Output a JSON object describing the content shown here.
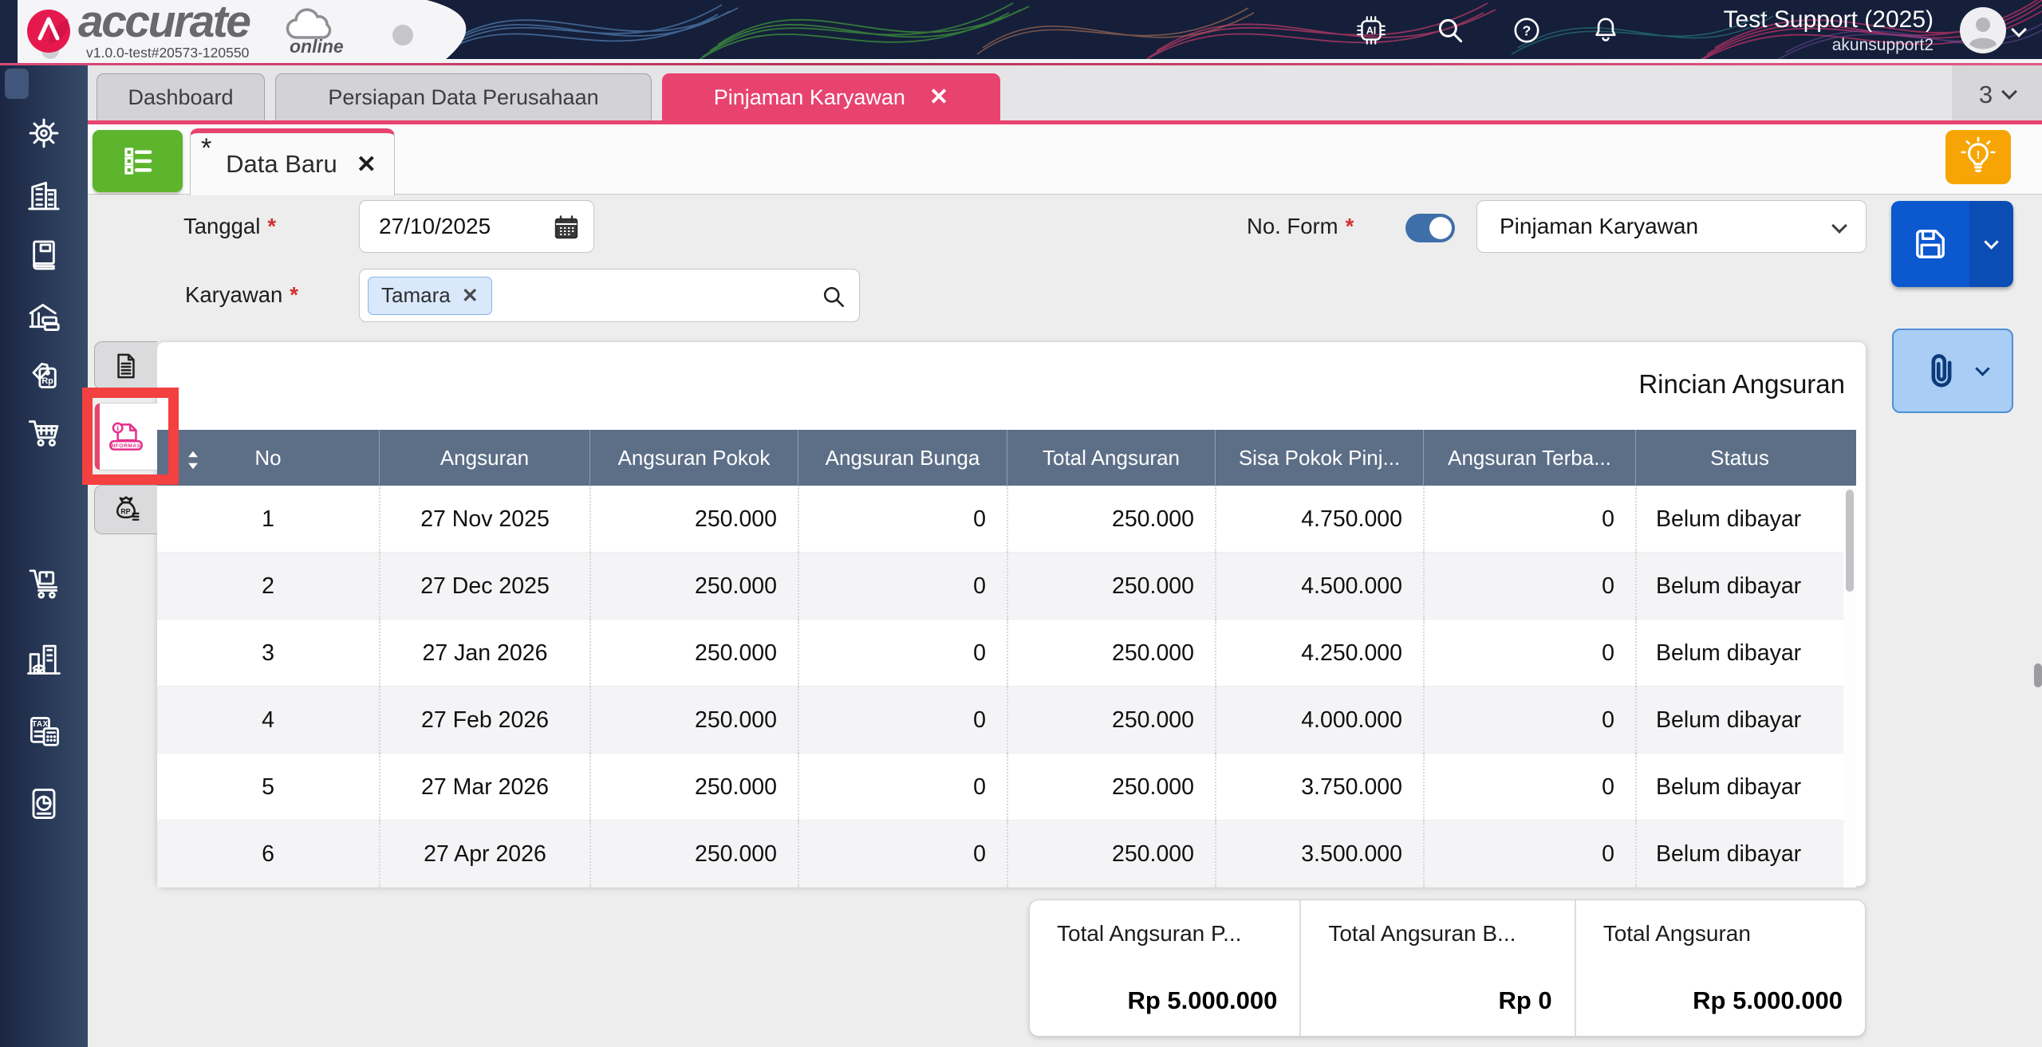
{
  "topbar": {
    "brand": "accurate",
    "brand_suffix": "online",
    "version": "v1.0.0-test#20573-120550",
    "user": {
      "name": "Test Support (2025)",
      "account": "akunsupport2"
    },
    "icons": [
      "ai-icon",
      "search-icon",
      "help-icon",
      "notifications-icon",
      "avatar",
      "chevron-down-icon"
    ]
  },
  "tabbar": {
    "tabs": [
      {
        "label": "Dashboard",
        "active": false
      },
      {
        "label": "Persiapan Data Perusahaan",
        "active": false
      },
      {
        "label": "Pinjaman Karyawan",
        "active": true,
        "closable": true
      }
    ],
    "overflow_count": "3"
  },
  "subtab": {
    "dirty_marker": "*",
    "label": "Data Baru",
    "closable": true,
    "list_button_icon": "list-icon"
  },
  "form": {
    "required_marker": "*",
    "tanggal": {
      "label": "Tanggal",
      "value": "27/10/2025",
      "icon": "calendar-icon"
    },
    "karyawan": {
      "label": "Karyawan",
      "chip": "Tamara",
      "icon": "search-icon"
    },
    "no_form": {
      "label": "No. Form",
      "toggle_on": true,
      "selected": "Pinjaman Karyawan"
    }
  },
  "panel": {
    "title": "Rincian Angsuran"
  },
  "table": {
    "columns": [
      "No",
      "Angsuran",
      "Angsuran Pokok",
      "Angsuran Bunga",
      "Total Angsuran",
      "Sisa Pokok Pinj...",
      "Angsuran Terba...",
      "Status"
    ],
    "rows": [
      [
        "1",
        "27 Nov 2025",
        "250.000",
        "0",
        "250.000",
        "4.750.000",
        "0",
        "Belum dibayar"
      ],
      [
        "2",
        "27 Dec 2025",
        "250.000",
        "0",
        "250.000",
        "4.500.000",
        "0",
        "Belum dibayar"
      ],
      [
        "3",
        "27 Jan 2026",
        "250.000",
        "0",
        "250.000",
        "4.250.000",
        "0",
        "Belum dibayar"
      ],
      [
        "4",
        "27 Feb 2026",
        "250.000",
        "0",
        "250.000",
        "4.000.000",
        "0",
        "Belum dibayar"
      ],
      [
        "5",
        "27 Mar 2026",
        "250.000",
        "0",
        "250.000",
        "3.750.000",
        "0",
        "Belum dibayar"
      ],
      [
        "6",
        "27 Apr 2026",
        "250.000",
        "0",
        "250.000",
        "3.500.000",
        "0",
        "Belum dibayar"
      ]
    ]
  },
  "totals": [
    {
      "label": "Total Angsuran P...",
      "value": "Rp 5.000.000"
    },
    {
      "label": "Total Angsuran B...",
      "value": "Rp 0"
    },
    {
      "label": "Total Angsuran",
      "value": "Rp 5.000.000"
    }
  ],
  "symbols": {
    "close": "✕",
    "question": "?",
    "ai": "AI",
    "tax": "TAX",
    "rp_bag": "RP",
    "rp_tag": "Rp",
    "informasi": "INFORMASI",
    "bang": "!"
  },
  "sidebar": {
    "items": [
      "settings-icon",
      "company-icon",
      "journal-book-icon",
      "cash-bank-icon",
      "sales-rp-tag-icon",
      "purchase-cart-icon",
      "inventory-trolley-icon",
      "fixed-assets-icon",
      "tax-icon",
      "reports-icon"
    ]
  },
  "side_tabs": [
    {
      "icon": "document-icon",
      "active": false
    },
    {
      "icon": "informasi-document-icon",
      "active": true,
      "highlighted": true
    },
    {
      "icon": "money-bag-icon",
      "active": false
    }
  ],
  "colors": {
    "accent_pink": "#e8436f",
    "table_header": "#5c6f87",
    "green_button": "#5cb52c",
    "save_blue": "#0b58cf",
    "save_blue_dark": "#0a4db4",
    "attach_bg": "#a9cdf4",
    "attach_border": "#4d8fd6",
    "attach_icon": "#0d3b7a",
    "hint_orange": "#f7a504",
    "highlight_red": "#f34040",
    "sidebar_navy_1": "#1a2644",
    "sidebar_navy_2": "#364a68",
    "topbar_navy": "#151f3a"
  }
}
